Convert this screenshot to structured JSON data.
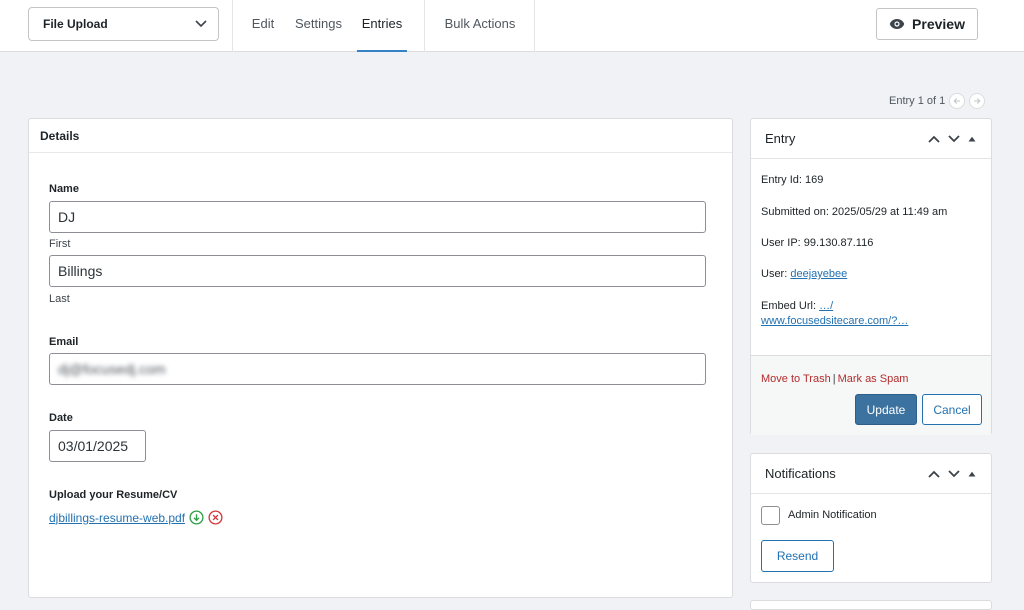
{
  "topbar": {
    "form_selector": "File Upload",
    "tabs": [
      {
        "label": "Edit"
      },
      {
        "label": "Settings"
      },
      {
        "label": "Entries",
        "active": true
      },
      {
        "label": "Bulk Actions"
      }
    ],
    "preview_label": "Preview"
  },
  "pager": {
    "text": "Entry 1 of 1"
  },
  "details": {
    "title": "Details",
    "name_label": "Name",
    "first_value": "DJ",
    "first_sublabel": "First",
    "last_value": "Billings",
    "last_sublabel": "Last",
    "email_label": "Email",
    "email_value": "dj@focusedj.com",
    "date_label": "Date",
    "date_value": "03/01/2025",
    "upload_label": "Upload your Resume/CV",
    "file_name": "djbillings-resume-web.pdf"
  },
  "entry": {
    "title": "Entry",
    "entry_id": "Entry Id: 169",
    "submitted": "Submitted on: 2025/05/29 at 11:49 am",
    "user_ip": "User IP: 99.130.87.116",
    "user_label": "User:",
    "user_value": "deejayebee",
    "embed_label": "Embed Url:",
    "embed_value_1": "…/",
    "embed_value_2": "www.focusedsitecare.com/?…",
    "trash_label": "Move to Trash",
    "divider": "|",
    "spam_label": "Mark as Spam",
    "update_label": "Update",
    "cancel_label": "Cancel"
  },
  "notifications": {
    "title": "Notifications",
    "admin_label": "Admin Notification",
    "resend_label": "Resend"
  },
  "colors": {
    "accent": "#2271b1",
    "primary_button": "#3b72a0",
    "danger": "#b32d2e",
    "download_icon": "#2e9e47",
    "delete_icon": "#d63638"
  }
}
